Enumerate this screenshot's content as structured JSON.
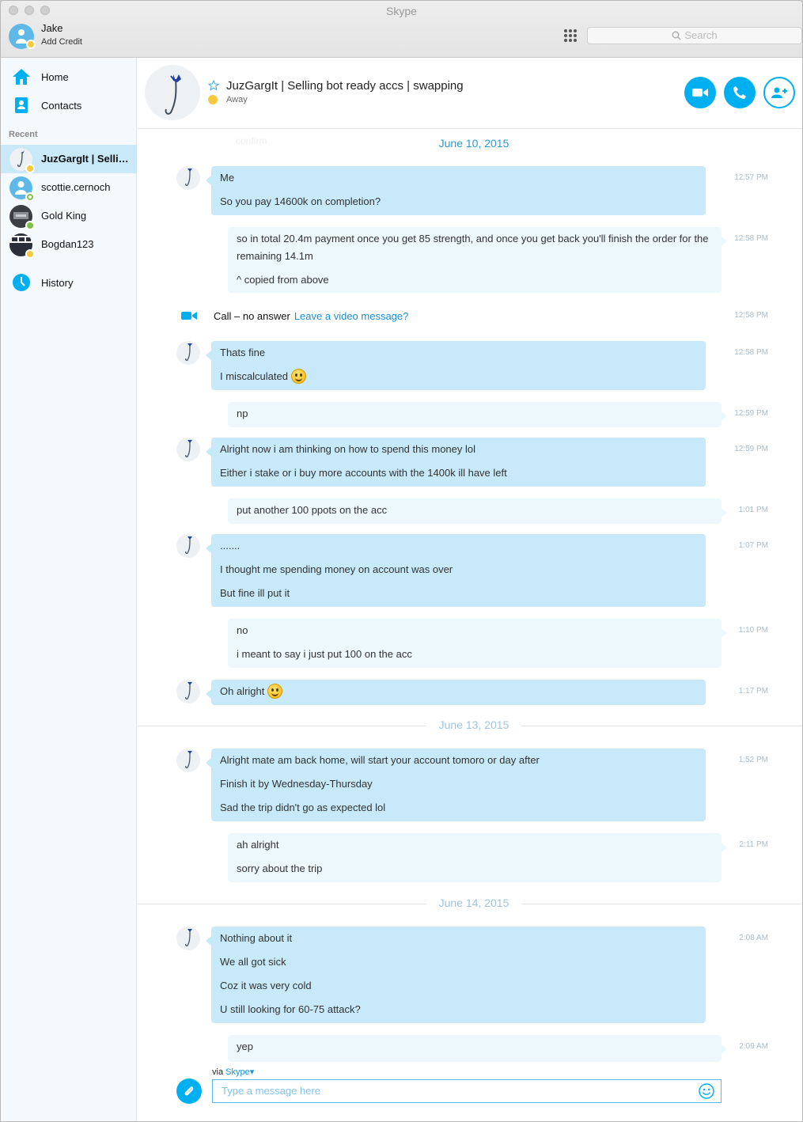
{
  "app": {
    "title": "Skype"
  },
  "me": {
    "name": "Jake",
    "credit_label": "Add Credit"
  },
  "search": {
    "placeholder": "Search"
  },
  "sidebar": {
    "nav": [
      {
        "label": "Home",
        "icon": "home-icon"
      },
      {
        "label": "Contacts",
        "icon": "contacts-icon"
      }
    ],
    "recent_header": "Recent",
    "contacts": [
      {
        "name": "JuzGargIt | Selling bot ready accs | swapping",
        "status": "away",
        "active": true
      },
      {
        "name": "scottie.cernoch",
        "status": "offline",
        "active": false
      },
      {
        "name": "Gold King",
        "status": "online",
        "active": false
      },
      {
        "name": "Bogdan123",
        "status": "away",
        "active": false
      }
    ],
    "history_label": "History"
  },
  "conversation": {
    "title": "JuzGargIt | Selling bot ready accs | swapping",
    "status": "Away",
    "ghost_text": "confirm"
  },
  "dates": [
    "June 10, 2015",
    "June 13, 2015",
    "June 14, 2015"
  ],
  "messages": [
    {
      "lines": [
        "Me",
        "So you pay 14600k on completion?"
      ],
      "time": "12:57 PM"
    },
    {
      "lines": [
        "so in total 20.4m payment once you get 85 strength, and once you get back you'll finish the order for the remaining 14.1m",
        "^ copied from above"
      ],
      "time": "12:58 PM"
    },
    {
      "call_text": "Call – no answer",
      "call_link": "Leave a video message?",
      "time": "12:58 PM"
    },
    {
      "lines": [
        "Thats fine",
        "I miscalculated"
      ],
      "time": "12:58 PM"
    },
    {
      "lines": [
        "np"
      ],
      "time": "12:59 PM"
    },
    {
      "lines": [
        "Alright now i am thinking on how to spend this money lol",
        "Either i stake or i buy more accounts with the 1400k ill have left"
      ],
      "time": "12:59 PM"
    },
    {
      "lines": [
        "put another 100 ppots on the acc"
      ],
      "time": "1:01 PM"
    },
    {
      "lines": [
        ".......",
        "I thought me spending money on account was over",
        "But fine ill put it"
      ],
      "time": "1:07 PM"
    },
    {
      "lines": [
        "no",
        "i meant to say i just put 100 on the acc"
      ],
      "time": "1:10 PM"
    },
    {
      "lines": [
        "Oh alright"
      ],
      "time": "1:17 PM"
    },
    {
      "lines": [
        "Alright mate am back home, will start your account tomoro or day after",
        "Finish it by Wednesday-Thursday",
        "Sad the trip didn't go as expected lol"
      ],
      "time": "1:52 PM"
    },
    {
      "lines": [
        "ah alright",
        "sorry about the trip"
      ],
      "time": "2:11 PM"
    },
    {
      "lines": [
        "Nothing about it",
        "We all got sick",
        "Coz it was very cold",
        "U still looking for 60-75 attack?"
      ],
      "time": "2:08 AM"
    },
    {
      "lines": [
        "yep"
      ],
      "time": "2:09 AM"
    }
  ],
  "composer": {
    "via_prefix": "via",
    "via_service": "Skype",
    "placeholder": "Type a message here"
  },
  "colors": {
    "accent": "#00aff0",
    "incoming_bubble": "#c7e9f9",
    "outgoing_bubble": "#edf8fd",
    "away": "#f7c93d",
    "online": "#7cc242"
  }
}
